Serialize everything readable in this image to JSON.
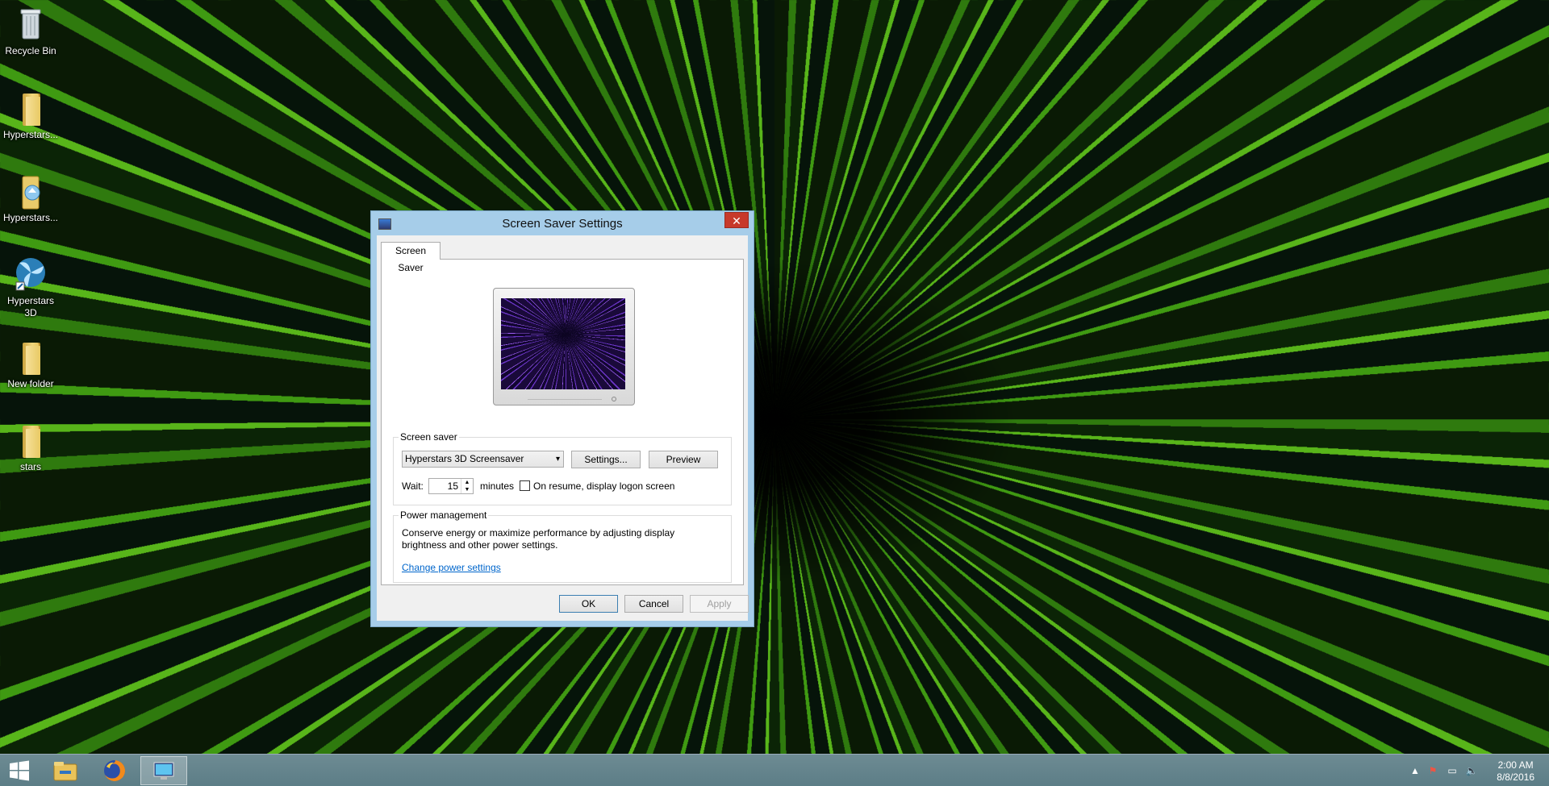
{
  "desktop": {
    "icons": [
      {
        "label": "Recycle Bin"
      },
      {
        "label": "Hyperstars..."
      },
      {
        "label": "Hyperstars..."
      },
      {
        "label": "Hyperstars 3D"
      },
      {
        "label": "New folder"
      },
      {
        "label": "stars"
      }
    ]
  },
  "dialog": {
    "title": "Screen Saver Settings",
    "close_glyph": "✕",
    "tab_label": "Screen Saver",
    "screensaver_group": {
      "title": "Screen saver",
      "selected": "Hyperstars 3D Screensaver",
      "settings_label": "Settings...",
      "preview_label": "Preview",
      "wait_label": "Wait:",
      "wait_value": "15",
      "minutes_label": "minutes",
      "resume_label": "On resume, display logon screen",
      "resume_checked": false
    },
    "power_group": {
      "title": "Power management",
      "description": "Conserve energy or maximize performance by adjusting display brightness and other power settings.",
      "link_label": "Change power settings"
    },
    "buttons": {
      "ok": "OK",
      "cancel": "Cancel",
      "apply": "Apply"
    }
  },
  "taskbar": {
    "time": "2:00 AM",
    "date": "8/8/2016",
    "apps": [
      "start-icon",
      "file-explorer-icon",
      "firefox-icon",
      "screen-saver-settings-icon"
    ]
  },
  "colors": {
    "dialog_frame": "#a6cde9",
    "close_button": "#c7392b",
    "link": "#0066cc",
    "taskbar": "#5c7d86"
  }
}
